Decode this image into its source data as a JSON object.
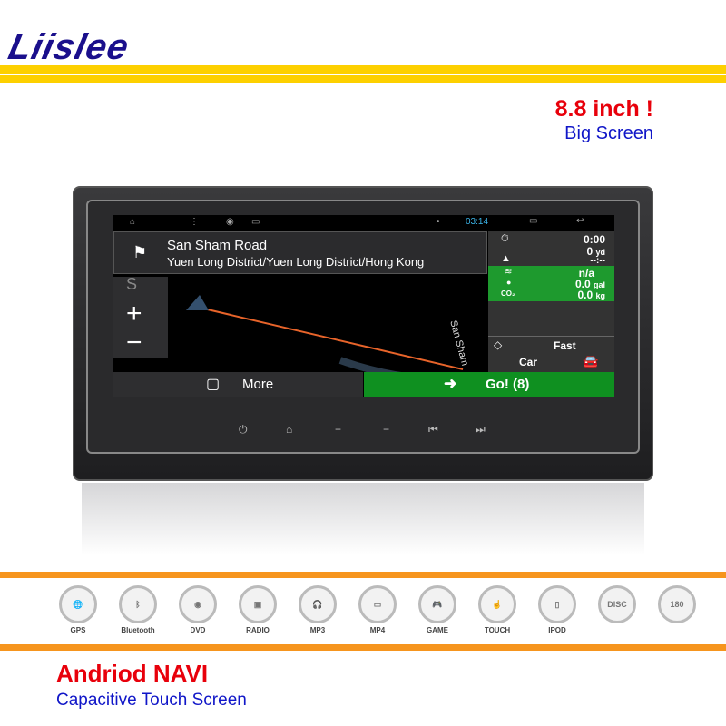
{
  "brand": {
    "logo": "Liislee"
  },
  "headline": {
    "size": "8.8 inch !",
    "sub": "Big Screen"
  },
  "screen": {
    "status": {
      "time": "03:14"
    },
    "destination": {
      "road": "San Sham Road",
      "district": "Yuen Long District/Yuen Long District/Hong Kong"
    },
    "trip": {
      "time": "0:00",
      "distance": "0",
      "distance_unit": "yd",
      "eta": "--:--"
    },
    "eco": {
      "value1": "n/a",
      "fuel": "0.0",
      "fuel_unit": "gal",
      "co2_label": "CO₂",
      "co2": "0.0",
      "co2_unit": "kg"
    },
    "route": {
      "mode": "Fast",
      "vehicle": "Car"
    },
    "map_label": "San Sham",
    "more_label": "More",
    "go_label": "Go! (8)",
    "route_color": "#e8642a",
    "go_color": "#0f9020"
  },
  "hardware_buttons": [
    "power",
    "home",
    "volume-up",
    "volume-down",
    "previous",
    "next"
  ],
  "hardware_glyphs": [
    "⏻",
    "⌂",
    "+",
    "−",
    "⏮",
    "⏭"
  ],
  "features": [
    {
      "label": "GPS",
      "icon": "🌐"
    },
    {
      "label": "Bluetooth",
      "icon": "ᛒ"
    },
    {
      "label": "DVD",
      "icon": "◉"
    },
    {
      "label": "RADIO",
      "icon": "▣"
    },
    {
      "label": "MP3",
      "icon": "🎧"
    },
    {
      "label": "MP4",
      "icon": "▭"
    },
    {
      "label": "GAME",
      "icon": "🎮"
    },
    {
      "label": "TOUCH",
      "icon": "☝"
    },
    {
      "label": "IPOD",
      "icon": "▯"
    },
    {
      "label": "",
      "icon": "DISC"
    },
    {
      "label": "",
      "icon": "180"
    }
  ],
  "footer": {
    "title": "Andriod NAVI",
    "subtitle": "Capacitive Touch Screen"
  }
}
